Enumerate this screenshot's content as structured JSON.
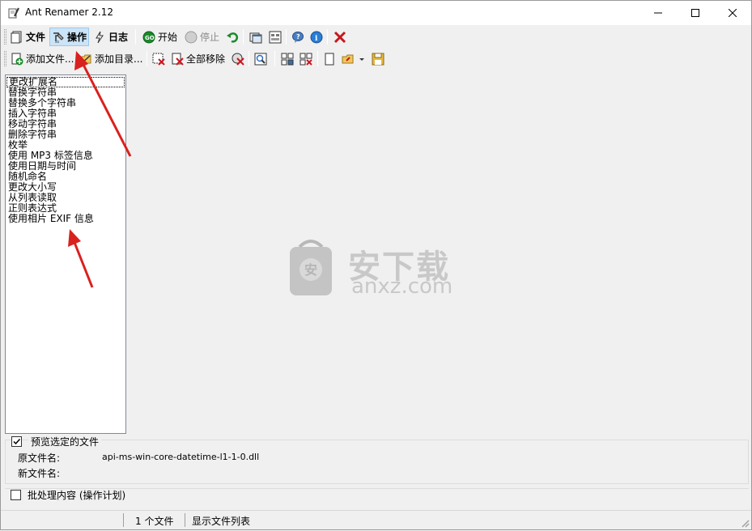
{
  "window": {
    "title": "Ant Renamer 2.12",
    "icon": "ant-renamer-app-icon"
  },
  "toolbar1": {
    "file_label": "文件",
    "actions_label": "操作",
    "log_label": "日志",
    "start_label": "开始",
    "stop_label": "停止"
  },
  "toolbar2": {
    "add_files_label": "添加文件...",
    "add_folder_label": "添加目录...",
    "remove_all_label": "全部移除"
  },
  "actions": [
    "更改扩展名",
    "替换字符串",
    "替换多个字符串",
    "插入字符串",
    "移动字符串",
    "删除字符串",
    "枚举",
    "使用 MP3 标签信息",
    "使用日期与时间",
    "随机命名",
    "更改大小写",
    "从列表读取",
    "正则表达式",
    "使用相片 EXIF 信息"
  ],
  "preview": {
    "checkbox_label": "预览选定的文件",
    "checked": true,
    "original_label": "原文件名:",
    "original_value": "api-ms-win-core-datetime-l1-1-0.dll",
    "new_label": "新文件名:",
    "new_value": ""
  },
  "batch": {
    "checkbox_label": "批处理内容 (操作计划)",
    "checked": false
  },
  "status": {
    "file_count": "1 个文件",
    "view_label": "显示文件列表"
  },
  "watermark": {
    "cn": "安下载",
    "en": "anxz.com"
  },
  "colors": {
    "annotation_arrow": "#d9211e",
    "selection": "#cce4f7",
    "go_green": "#1a8a2a"
  }
}
